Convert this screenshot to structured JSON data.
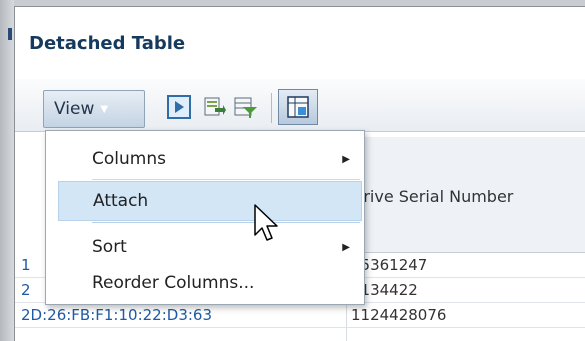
{
  "title": "Detached Table",
  "toolbar": {
    "view_label": "View",
    "icons": [
      "play-icon",
      "export-icon",
      "filter-icon",
      "freeze-icon"
    ]
  },
  "menu": {
    "items": [
      {
        "label": "Columns",
        "has_submenu": true
      },
      {
        "label": "Attach",
        "has_submenu": false,
        "highlighted": true
      },
      {
        "label": "Sort",
        "has_submenu": true
      },
      {
        "label": "Reorder Columns...",
        "has_submenu": false
      }
    ]
  },
  "table": {
    "header": "Drive Serial Number",
    "rows": [
      {
        "c1": "1",
        "c2": "95361247"
      },
      {
        "c1": "2",
        "c2": "3134422"
      },
      {
        "c1": "2D:26:FB:F1:10:22:D3:63",
        "c2": "1124428076"
      }
    ]
  },
  "colors": {
    "title": "#16395e",
    "menu_highlight": "#d3e6f6",
    "link": "#1f5aa6"
  }
}
